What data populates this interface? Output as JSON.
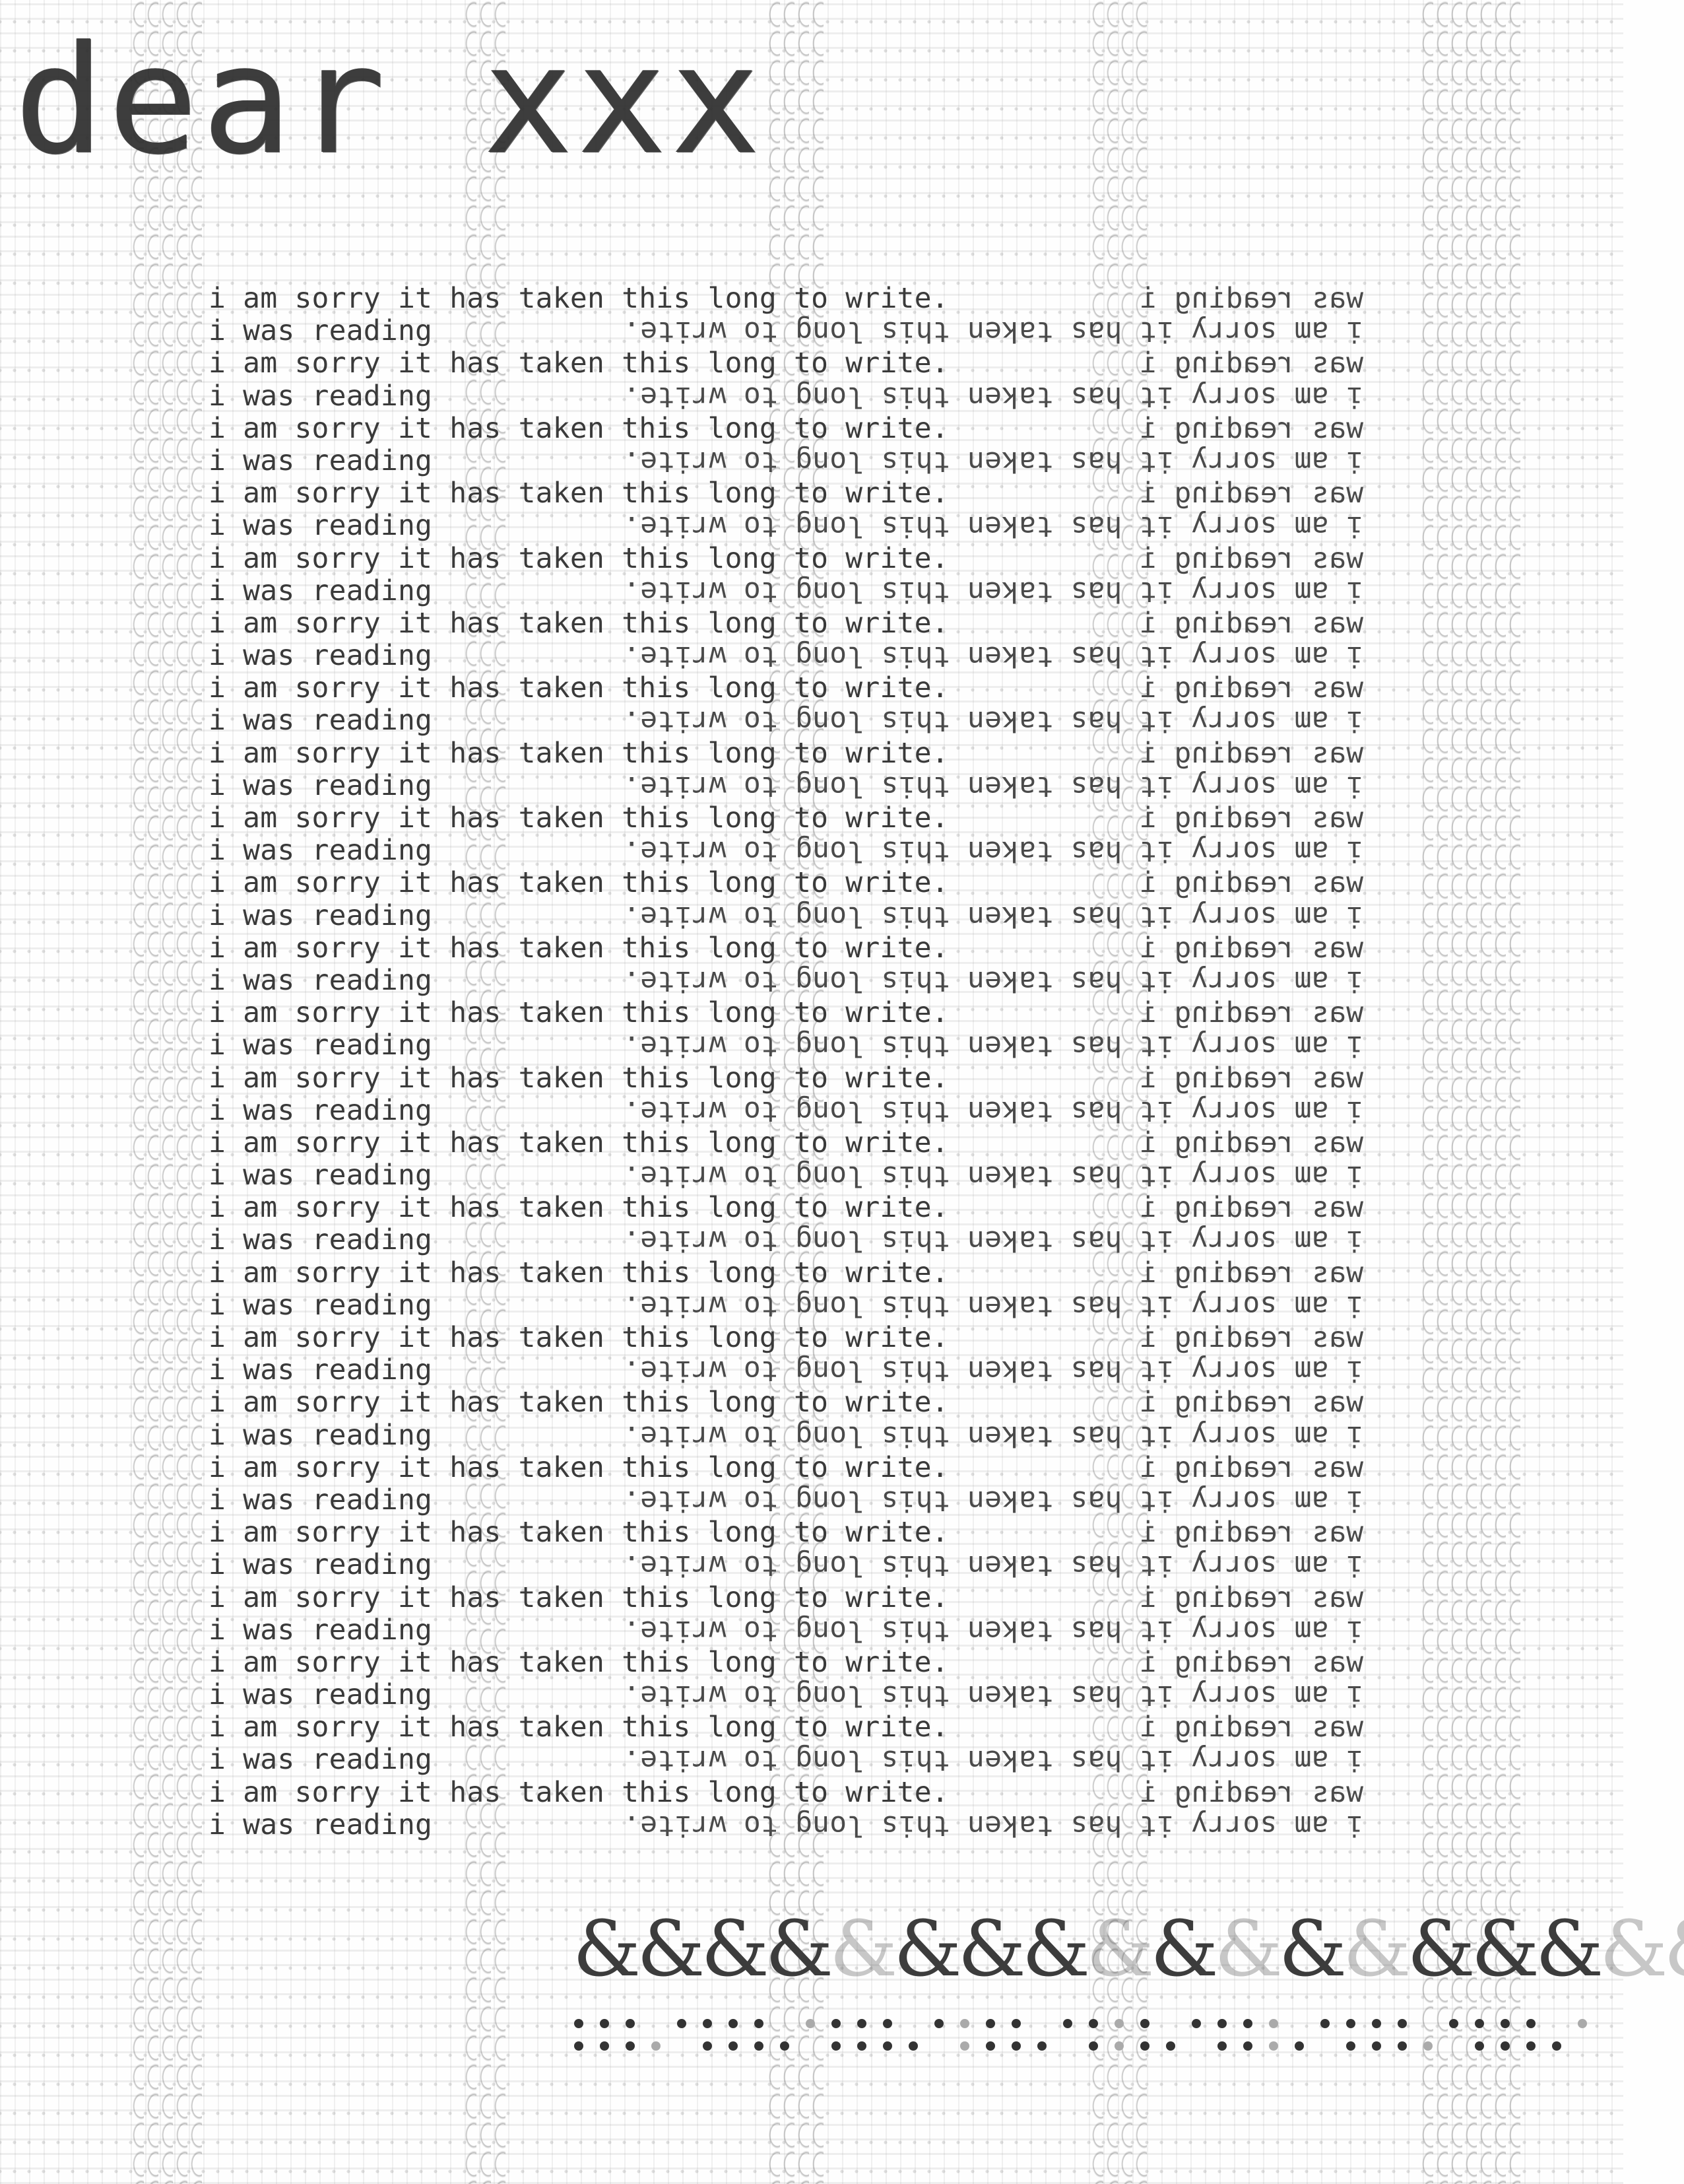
{
  "title": "dear xxx",
  "letter": {
    "line_forward": "i am sorry it has taken this long to write.",
    "line_reading": "i was reading",
    "line_mirrored": "was reading",
    "line_mirrored_b": "am sorry it has taken this long to write.",
    "line_prefix": "i",
    "rows": 24
  },
  "ornament": {
    "amp_glyph": "&",
    "dot_glyph": "•"
  }
}
